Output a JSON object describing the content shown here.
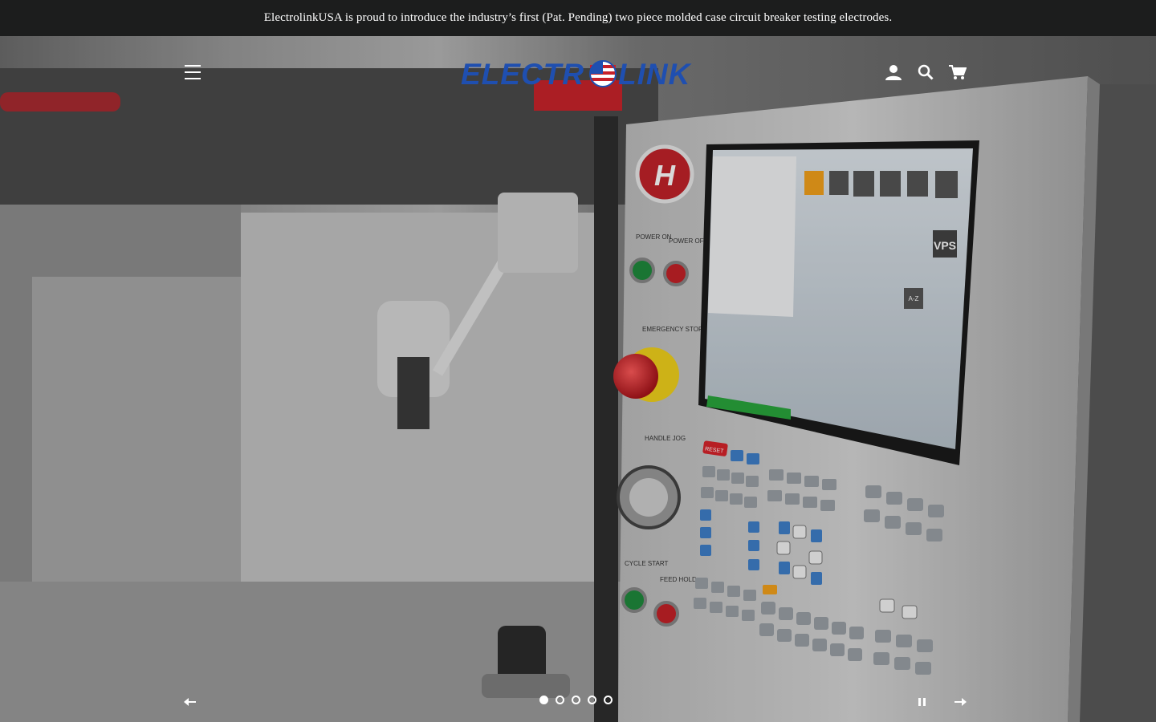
{
  "announcement": {
    "text": "ElectrolinkUSA is proud to introduce the industry’s first (Pat. Pending) two piece molded case circuit breaker testing electrodes."
  },
  "header": {
    "logo": {
      "part1": "ELECTR",
      "part2": "LINK",
      "color": "#1f4fb0"
    },
    "icons": [
      "account-icon",
      "search-icon",
      "cart-icon"
    ]
  },
  "hero": {
    "panel_labels": {
      "power_on": "POWER ON",
      "power_off": "POWER OFF",
      "emergency_stop": "EMERGENCY STOP",
      "handle_jog": "HANDLE JOG",
      "cycle_start": "CYCLE START",
      "feed_hold": "FEED HOLD",
      "reset": "RESET",
      "vps": "VPS",
      "az": "A-Z"
    }
  },
  "slider": {
    "dot_count": 5,
    "active_index": 0
  },
  "colors": {
    "bar": "#1c1d1d",
    "white": "#ffffff",
    "accent_red": "#d3202a",
    "accent_blue": "#1f4fb0"
  }
}
